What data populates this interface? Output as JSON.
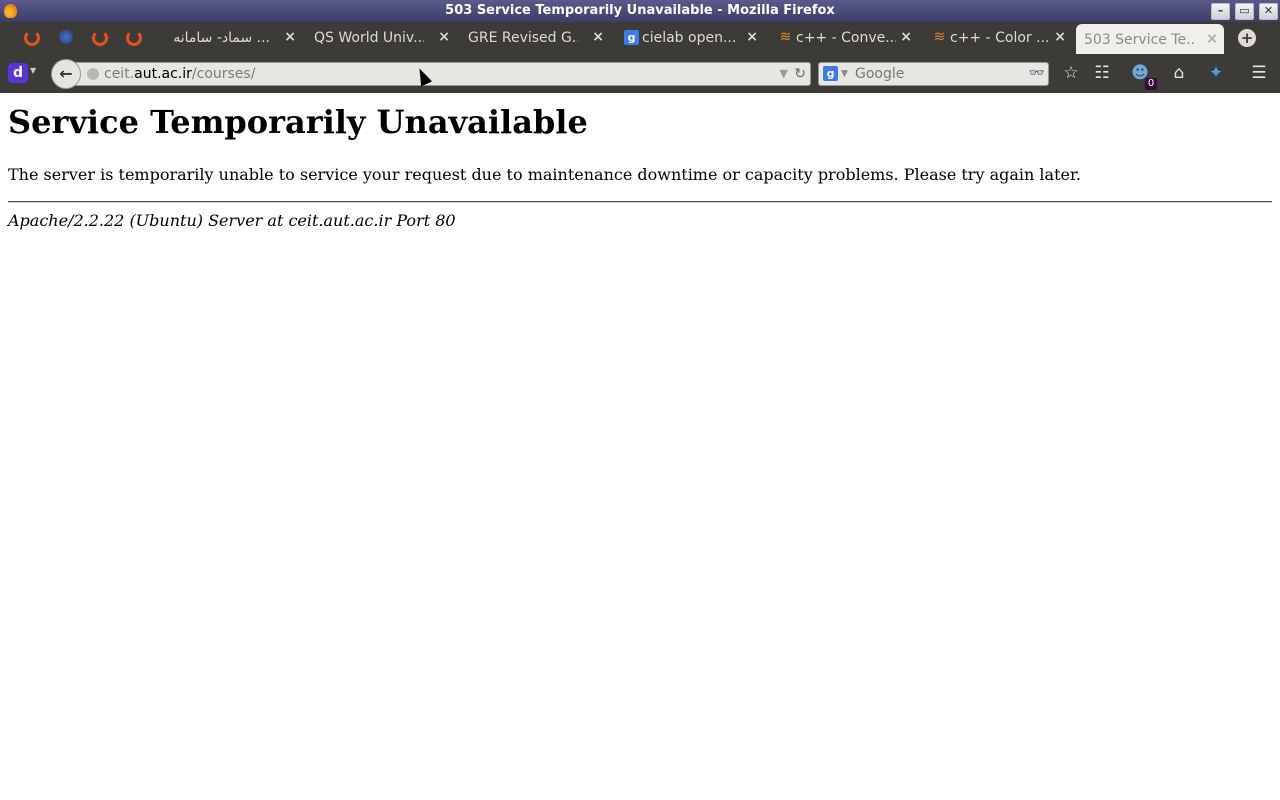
{
  "window": {
    "title": "503 Service Temporarily Unavailable - Mozilla Firefox",
    "controls": [
      "minimize",
      "maximize",
      "close"
    ]
  },
  "tabs": {
    "pinned": [
      "firefox-icon",
      "globe-icon",
      "firefox-icon",
      "firefox-icon"
    ],
    "items": [
      {
        "title": "... سماد- سامانه",
        "icon": "",
        "close": "×"
      },
      {
        "title": "QS World Univ...",
        "icon": "",
        "close": "×"
      },
      {
        "title": "GRE Revised G...",
        "icon": "",
        "close": "×"
      },
      {
        "title": "cielab open...",
        "icon": "google-icon",
        "close": "×"
      },
      {
        "title": "c++ - Conve...",
        "icon": "stackoverflow-icon",
        "close": "×"
      },
      {
        "title": "c++ - Color ...",
        "icon": "stackoverflow-icon",
        "close": "×"
      },
      {
        "title": "503 Service Te...",
        "icon": "",
        "close": "×",
        "active": true
      }
    ],
    "new_tab": "+"
  },
  "navbar": {
    "disconnect_label": "d",
    "back": "←",
    "url": {
      "prefix": "ceit.",
      "domain": "aut.ac.ir",
      "path": "/courses/"
    },
    "search": {
      "engine": "g",
      "placeholder": "Google"
    },
    "ghostery_count": "0"
  },
  "page": {
    "heading": "Service Temporarily Unavailable",
    "message": "The server is temporarily unable to service your request due to maintenance downtime or capacity problems. Please try again later.",
    "footer": "Apache/2.2.22 (Ubuntu) Server at ceit.aut.ac.ir Port 80"
  },
  "colors": {
    "titlebar": "#4b4b7a",
    "chrome": "#3c3b37",
    "active_tab": "#f0efec",
    "pinned_firefox": "#e8501c"
  }
}
